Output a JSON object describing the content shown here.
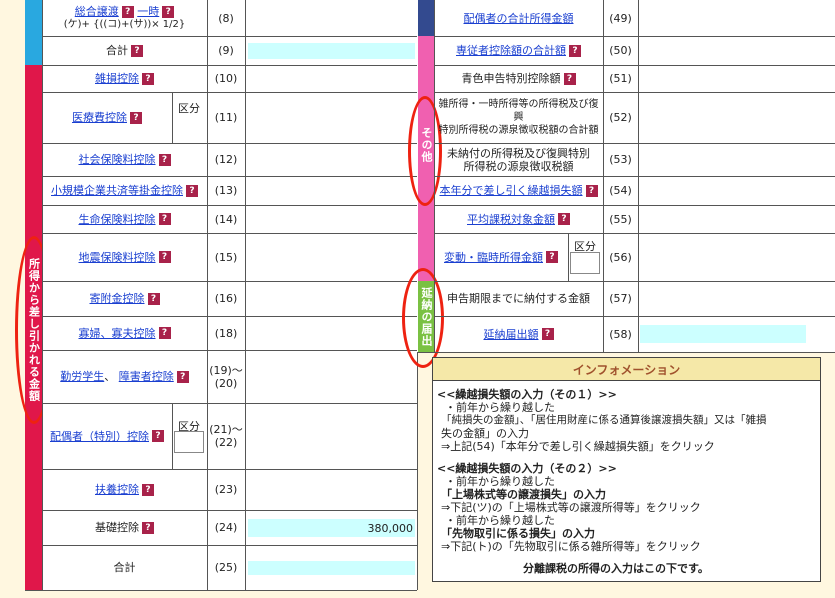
{
  "left_rows": [
    {
      "id": "sougou",
      "label_parts": [
        "総合譲渡",
        "一時"
      ],
      "sub": "(ケ)+ {((コ)+(サ))× 1/2}",
      "num": "(8)"
    },
    {
      "id": "goukei1",
      "label": "合計",
      "num": "(9)"
    },
    {
      "id": "zasson",
      "label": "雑損控除",
      "num": "(10)"
    },
    {
      "id": "iryouhi",
      "label": "医療費控除",
      "num": "(11)",
      "kubun": "区分"
    },
    {
      "id": "shakai",
      "label": "社会保険料控除",
      "num": "(12)"
    },
    {
      "id": "shoukibo",
      "label": "小規模企業共済等掛金控除",
      "num": "(13)"
    },
    {
      "id": "seimei",
      "label": "生命保険料控除",
      "num": "(14)"
    },
    {
      "id": "jishin",
      "label": "地震保険料控除",
      "num": "(15)"
    },
    {
      "id": "kifukin",
      "label": "寄附金控除",
      "num": "(16)"
    },
    {
      "id": "kafu",
      "label": "寡婦、寡夫控除",
      "num": "(18)"
    },
    {
      "id": "kinrou",
      "label_parts": [
        "勤労学生",
        "障害者控除"
      ],
      "num1": "(19)～",
      "num2": "(20)"
    },
    {
      "id": "haigusha",
      "label": "配偶者（特別）控除",
      "num1": "(21)～",
      "num2": "(22)",
      "kubun": "区分"
    },
    {
      "id": "fuyou",
      "label": "扶養控除",
      "num": "(23)"
    },
    {
      "id": "kiso",
      "label": "基礎控除",
      "num": "(24)",
      "value": "380,000"
    },
    {
      "id": "goukei2",
      "label": "合計",
      "num": "(25)"
    }
  ],
  "left_band_label": "所得から差し引かれる金額",
  "right_rows": [
    {
      "id": "haigusha_gokei",
      "label": "配偶者の合計所得金額",
      "num": "(49)",
      "link": true
    },
    {
      "id": "senju",
      "label": "専従者控除額の合計額",
      "num": "(50)",
      "link": true
    },
    {
      "id": "aoiro",
      "label": "青色申告特別控除額",
      "num": "(51)",
      "link": false
    },
    {
      "id": "zatsushotoku",
      "lines": [
        "雑所得・一時所得等の所得税及び復",
        "興",
        "特別所得税の源泉徴収税額の合計額"
      ],
      "num": "(52)"
    },
    {
      "id": "minoufu",
      "lines": [
        "未納付の所得税及び復興特別",
        "所得税の源泉徴収税額"
      ],
      "num": "(53)"
    },
    {
      "id": "honnen",
      "label": "本年分で差し引く繰越損失額",
      "num": "(54)",
      "link": true
    },
    {
      "id": "heikin",
      "label": "平均課税対象金額",
      "num": "(55)",
      "link": true
    },
    {
      "id": "hendou",
      "label": "変動・臨時所得金額",
      "num": "(56)",
      "link": true,
      "kubun": "区分"
    },
    {
      "id": "shinkoku",
      "label": "申告期限までに納付する金額",
      "num": "(57)",
      "link": false
    },
    {
      "id": "ennou",
      "label": "延納届出額",
      "num": "(58)",
      "link": true
    }
  ],
  "right_band_sonota": "その他",
  "right_band_ennou": "延納の届出",
  "info": {
    "title": "インフォメーション",
    "lines": [
      "<<繰越損失額の入力（その１）>>",
      "・前年から繰り越した",
      "「純損失の金額」、「居住用財産に係る通算後譲渡損失額」又は「雑損",
      "失の金額」の入力",
      "⇒上記(54)「本年分で差し引く繰越損失額」をクリック",
      "",
      "<<繰越損失額の入力（その２）>>",
      "・前年から繰り越した",
      "「上場株式等の譲渡損失」の入力",
      "⇒下記(ツ)の「上場株式等の譲渡所得等」をクリック",
      "・前年から繰り越した",
      "「先物取引に係る損失」の入力",
      "⇒下記(ト)の「先物取引に係る雑所得等」をクリック",
      "",
      "分離課税の所得の入力はこの下です。"
    ]
  },
  "help_icon": "?",
  "colors": {
    "band_blue": "#29a8e0",
    "band_red": "#e0174a",
    "band_pink": "#f060b0",
    "band_green": "#7ac143",
    "cyan": "#ccffff",
    "oval": "#e21111"
  }
}
